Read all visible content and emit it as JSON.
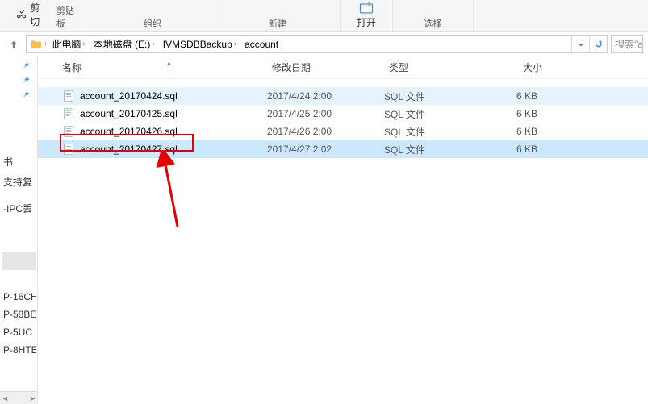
{
  "ribbon": {
    "cutoff_label": "剪切",
    "groups": {
      "clipboard": "剪贴板",
      "organize": "组织",
      "new": "新建",
      "open": "打开",
      "select": "选择"
    }
  },
  "breadcrumb": {
    "items": [
      "此电脑",
      "本地磁盘 (E:)",
      "IVMSDBBackup",
      "account"
    ]
  },
  "search": {
    "placeholder": "搜索\"a"
  },
  "columns": {
    "name": "名称",
    "date": "修改日期",
    "type": "类型",
    "size": "大小"
  },
  "files": [
    {
      "name": "account_20170424.sql",
      "date": "2017/4/24 2:00",
      "type": "SQL 文件",
      "size": "6 KB",
      "sel": "sel1"
    },
    {
      "name": "account_20170425.sql",
      "date": "2017/4/25 2:00",
      "type": "SQL 文件",
      "size": "6 KB",
      "sel": ""
    },
    {
      "name": "account_20170426.sql",
      "date": "2017/4/26 2:00",
      "type": "SQL 文件",
      "size": "6 KB",
      "sel": ""
    },
    {
      "name": "account_20170427.sql",
      "date": "2017/4/27 2:02",
      "type": "SQL 文件",
      "size": "6 KB",
      "sel": "sel2"
    }
  ],
  "leftnav": {
    "items_top": [
      "",
      "",
      ""
    ],
    "items_mid": [
      "书",
      "支持复",
      "",
      "-IPC丢"
    ],
    "items_bottom": [
      "P-16CH",
      "P-58BE",
      "P-5UC",
      "P-8HTE"
    ]
  }
}
